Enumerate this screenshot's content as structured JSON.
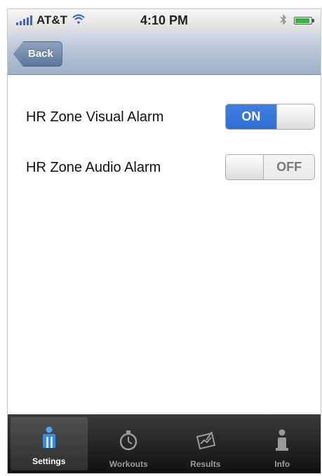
{
  "status_bar": {
    "carrier": "AT&T",
    "time": "4:10 PM",
    "icons": [
      "signal-icon",
      "wifi-icon",
      "bluetooth-icon",
      "battery-icon"
    ]
  },
  "nav": {
    "back_label": "Back"
  },
  "settings": [
    {
      "label": "HR Zone Visual Alarm",
      "state": "ON"
    },
    {
      "label": "HR Zone Audio Alarm",
      "state": "OFF"
    }
  ],
  "tabs": [
    {
      "label": "Settings",
      "icon": "settings-person-icon",
      "active": true
    },
    {
      "label": "Workouts",
      "icon": "stopwatch-icon",
      "active": false
    },
    {
      "label": "Results",
      "icon": "results-chart-icon",
      "active": false
    },
    {
      "label": "Info",
      "icon": "info-icon",
      "active": false
    }
  ],
  "colors": {
    "toggle_on": "#2f6ed6",
    "nav_bar": "#b3c1d3",
    "tab_bar": "#111111"
  }
}
